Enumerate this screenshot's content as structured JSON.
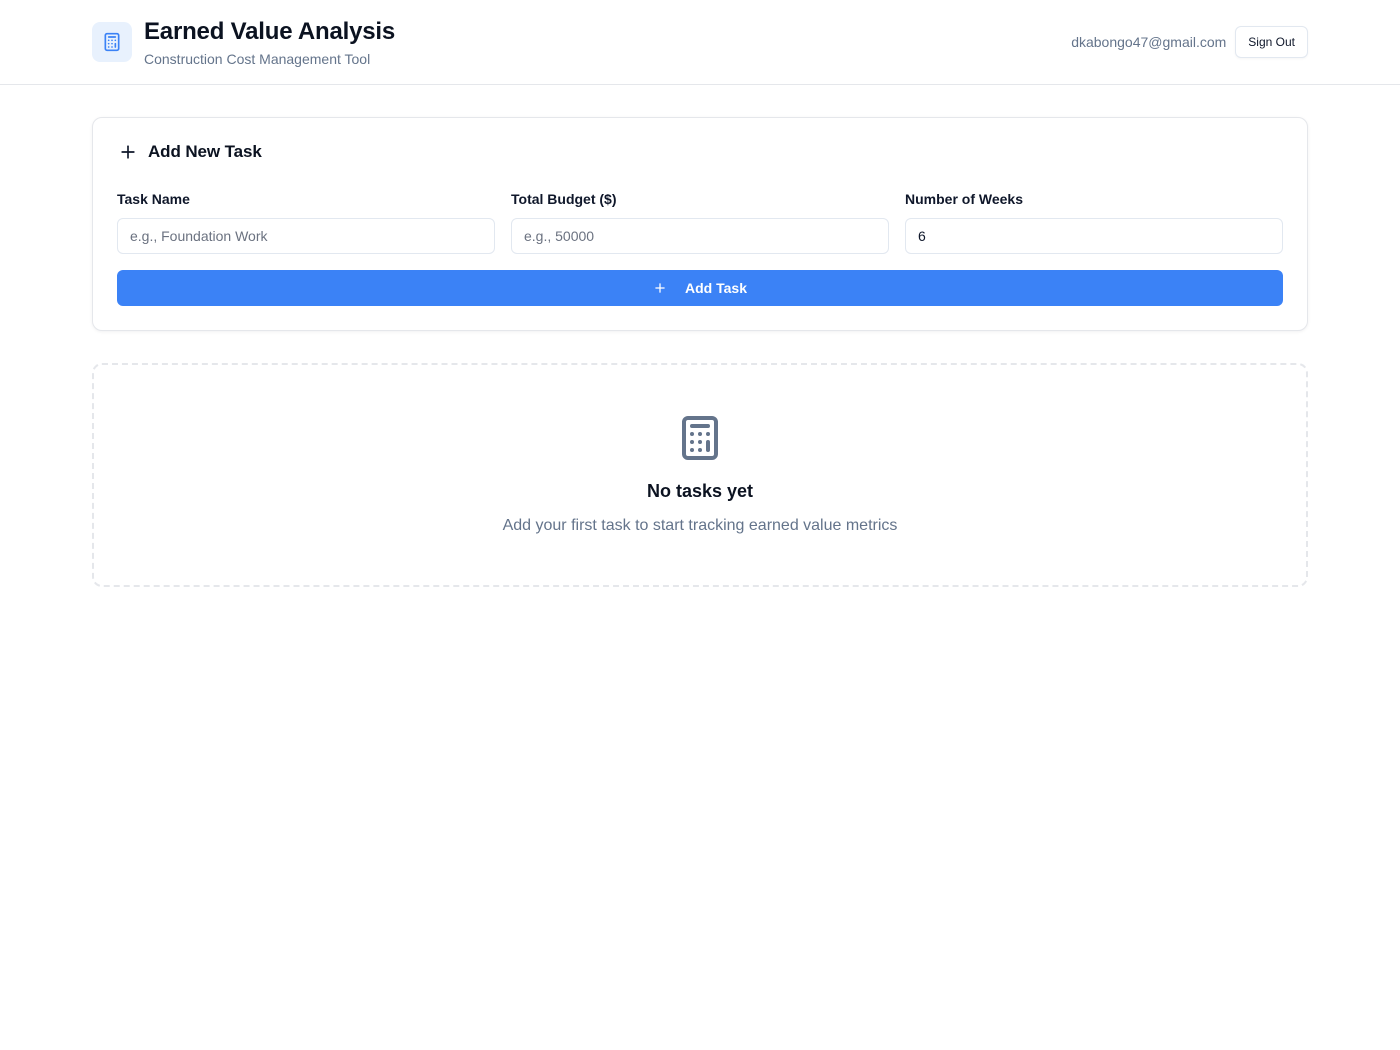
{
  "header": {
    "title": "Earned Value Analysis",
    "subtitle": "Construction Cost Management Tool",
    "brand_icon": "calculator-icon",
    "user_email": "dkabongo47@gmail.com",
    "sign_out_label": "Sign Out"
  },
  "add_task_card": {
    "title": "Add New Task",
    "title_icon": "plus-icon",
    "fields": [
      {
        "label": "Task Name",
        "placeholder": "e.g., Foundation Work",
        "value": ""
      },
      {
        "label": "Total Budget ($)",
        "placeholder": "e.g., 50000",
        "value": ""
      },
      {
        "label": "Number of Weeks",
        "placeholder": "",
        "value": "6"
      }
    ],
    "submit_label": "Add Task"
  },
  "empty_state": {
    "icon": "calculator-icon",
    "title": "No tasks yet",
    "description": "Add your first task to start tracking earned value metrics"
  },
  "colors": {
    "accent": "#3b82f6",
    "brand_icon_bg": "#e8f1fd",
    "muted_text": "#64748b",
    "border": "#e5e7eb"
  }
}
